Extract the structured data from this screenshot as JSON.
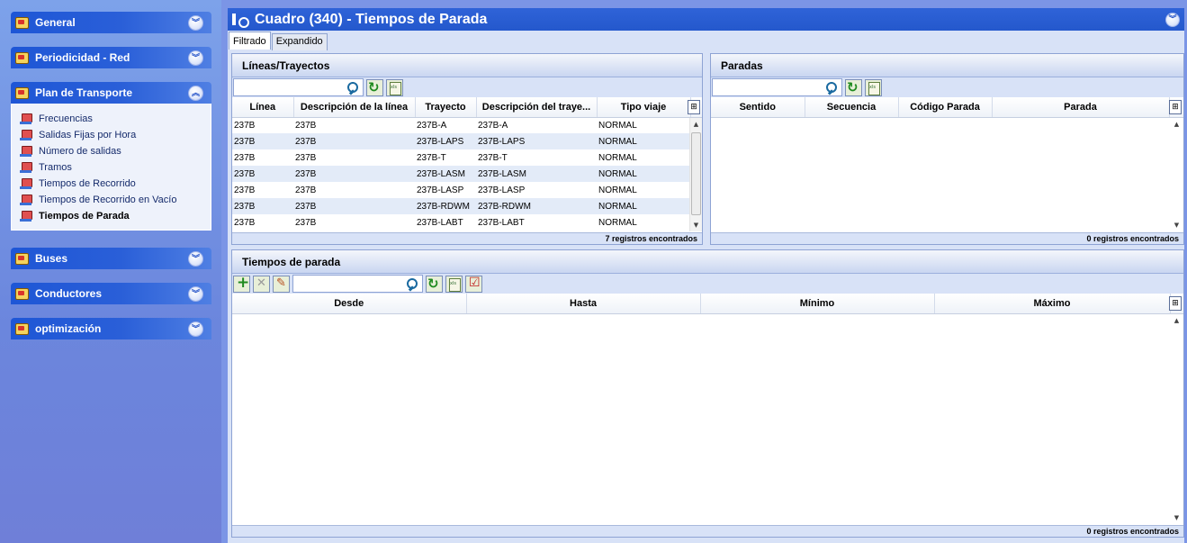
{
  "sidebar": {
    "groups": [
      {
        "label": "General",
        "icon": "general-icon",
        "expanded": false
      },
      {
        "label": "Periodicidad - Red",
        "icon": "periodicidad-icon",
        "expanded": false
      },
      {
        "label": "Plan de Transporte",
        "icon": "plan-transporte-icon",
        "expanded": true,
        "items": [
          {
            "label": "Frecuencias"
          },
          {
            "label": "Salidas Fijas por Hora"
          },
          {
            "label": "Número de salidas"
          },
          {
            "label": "Tramos"
          },
          {
            "label": "Tiempos de Recorrido"
          },
          {
            "label": "Tiempos de Recorrido en Vacío"
          },
          {
            "label": "Tiempos de Parada",
            "active": true
          }
        ]
      },
      {
        "label": "Buses",
        "icon": "bus-icon",
        "expanded": false
      },
      {
        "label": "Conductores",
        "icon": "conductores-icon",
        "expanded": false
      },
      {
        "label": "optimización",
        "icon": "optimizacion-icon",
        "expanded": false
      }
    ]
  },
  "window": {
    "title": "Cuadro (340) - Tiempos de Parada"
  },
  "tabs": [
    "Filtrado",
    "Expandido"
  ],
  "lineas": {
    "title": "Líneas/Trayectos",
    "search": "",
    "columns": [
      "Línea",
      "Descripción de la línea",
      "Trayecto",
      "Descripción del traye...",
      "Tipo viaje"
    ],
    "rows": [
      [
        "237B",
        "237B",
        "237B-A",
        "237B-A",
        "NORMAL"
      ],
      [
        "237B",
        "237B",
        "237B-LAPS",
        "237B-LAPS",
        "NORMAL"
      ],
      [
        "237B",
        "237B",
        "237B-T",
        "237B-T",
        "NORMAL"
      ],
      [
        "237B",
        "237B",
        "237B-LASM",
        "237B-LASM",
        "NORMAL"
      ],
      [
        "237B",
        "237B",
        "237B-LASP",
        "237B-LASP",
        "NORMAL"
      ],
      [
        "237B",
        "237B",
        "237B-RDWM",
        "237B-RDWM",
        "NORMAL"
      ],
      [
        "237B",
        "237B",
        "237B-LABT",
        "237B-LABT",
        "NORMAL"
      ]
    ],
    "status": "7 registros encontrados"
  },
  "paradas": {
    "title": "Paradas",
    "search": "",
    "columns": [
      "Sentido",
      "Secuencia",
      "Código Parada",
      "Parada"
    ],
    "status": "0 registros encontrados"
  },
  "tiempos": {
    "title": "Tiempos de parada",
    "search": "",
    "columns": [
      "Desde",
      "Hasta",
      "Mínimo",
      "Máximo"
    ],
    "status": "0 registros encontrados"
  }
}
